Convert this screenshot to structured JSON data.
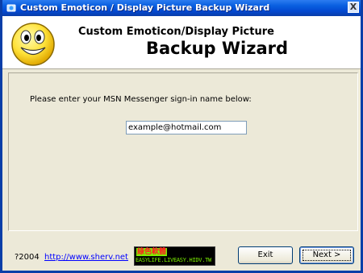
{
  "window": {
    "title": "Custom Emoticon / Display Picture Backup Wizard",
    "close_label": "X"
  },
  "header": {
    "title": "Custom Emoticon/Display Picture",
    "subtitle": "Backup Wizard",
    "logo_icon": "smiley-icon"
  },
  "form": {
    "prompt": "Please enter your MSN Messenger sign-in name below:",
    "signin_value": "example@hotmail.com"
  },
  "footer": {
    "copyright": "?2004",
    "link": "http://www.sherv.net",
    "banner_top": "綠色軟體",
    "banner_bottom": "EASYLIFE.LIVEASY.HIDV.TW",
    "exit_label": "Exit",
    "next_label": "Next >"
  },
  "colors": {
    "titlebar": "#0a5fe0",
    "window_bg": "#ece9d8",
    "link": "#0000ff"
  }
}
